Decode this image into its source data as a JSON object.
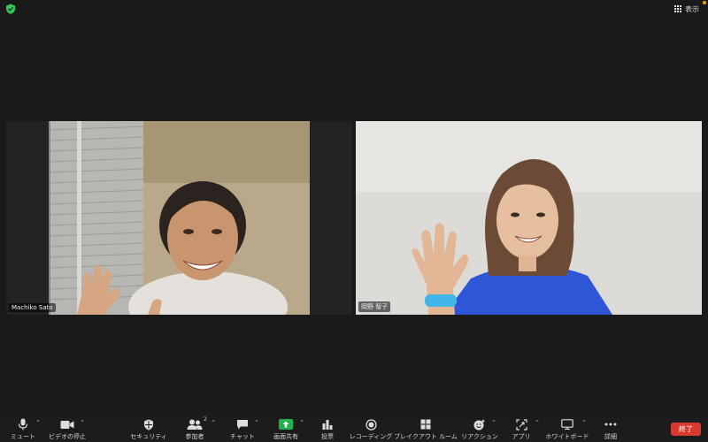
{
  "topbar": {
    "view_label": "表示"
  },
  "participants": [
    {
      "name": "Machiko Sato"
    },
    {
      "name": "岡野 智子"
    }
  ],
  "toolbar": {
    "mute": "ミュート",
    "stop_video": "ビデオの停止",
    "security": "セキュリティ",
    "participants": "参加者",
    "participants_count": "2",
    "chat": "チャット",
    "share_screen": "画面共有",
    "polls": "投票",
    "recording": "レコーディング",
    "breakout_rooms": "ブレイクアウト ルーム",
    "reactions": "リアクション",
    "apps": "アプリ",
    "whiteboard": "ホワイトボード",
    "more": "詳細",
    "end": "終了"
  },
  "colors": {
    "background": "#1a1a1a",
    "share_green": "#22b14c",
    "end_red": "#d93a30",
    "shield_green": "#35c759"
  }
}
